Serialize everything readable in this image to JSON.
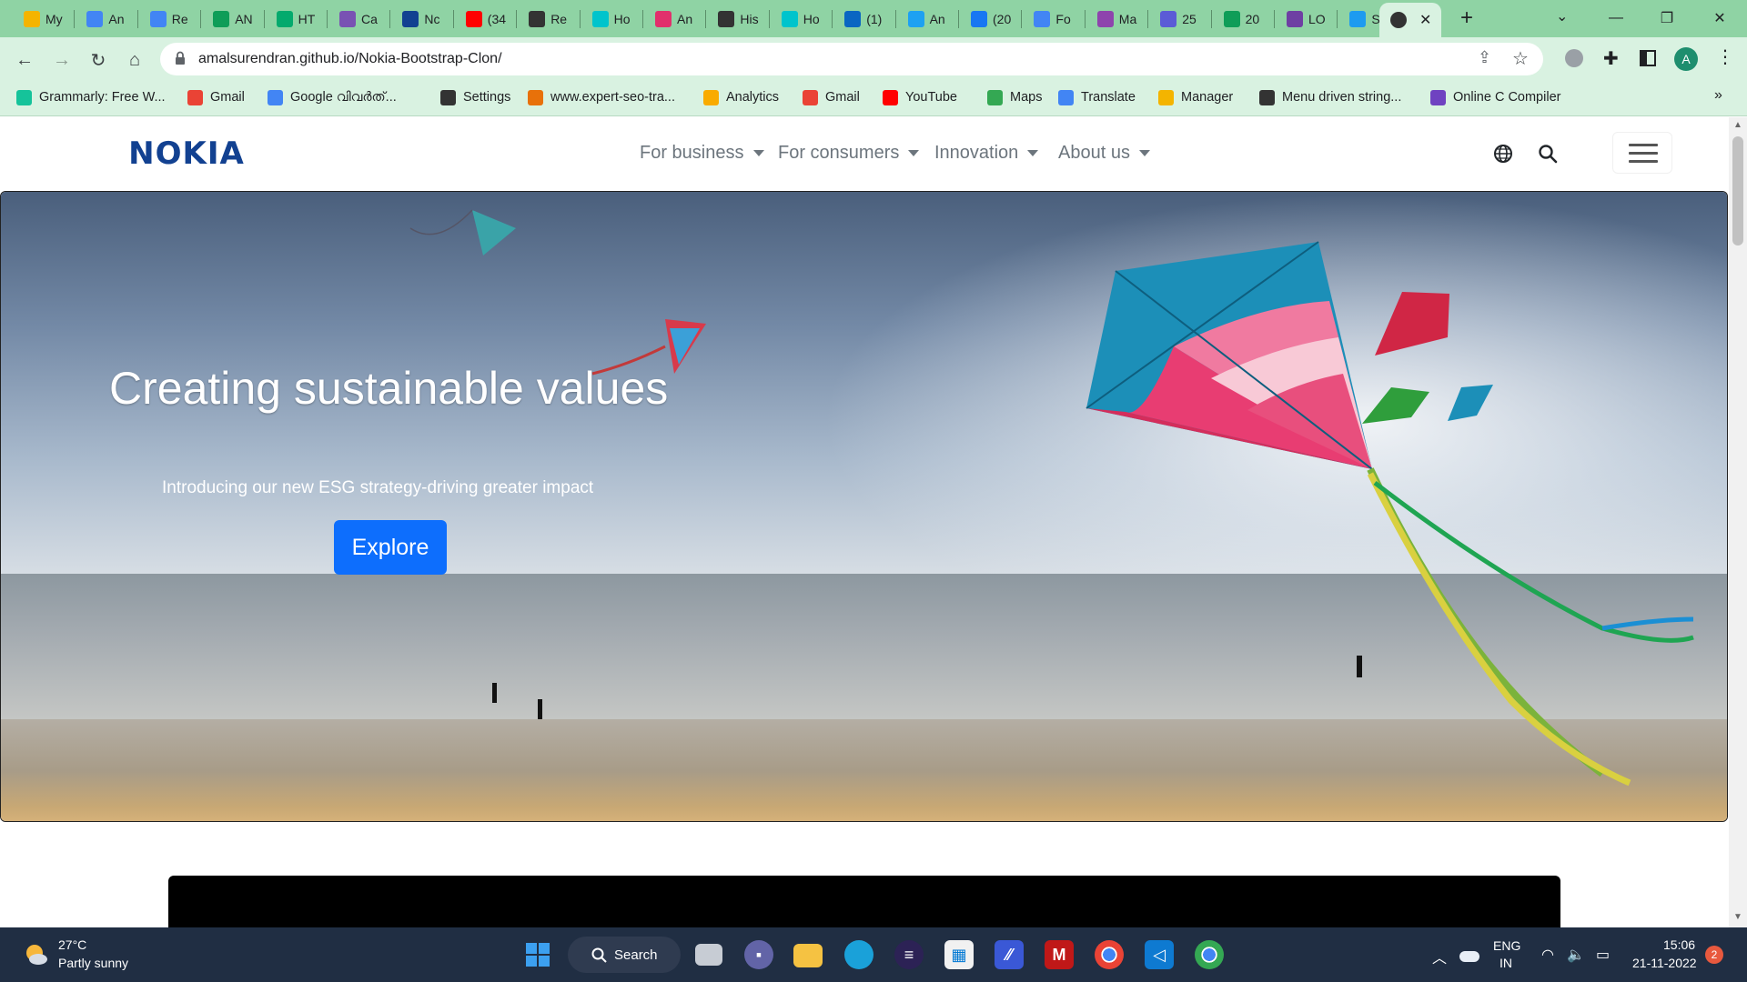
{
  "browser": {
    "tabs": [
      {
        "label": "My",
        "icon": "google-drive-icon",
        "color": "#f4b400"
      },
      {
        "label": "An",
        "icon": "google-docs-icon",
        "color": "#4285f4"
      },
      {
        "label": "Re",
        "icon": "google-docs-icon",
        "color": "#4285f4"
      },
      {
        "label": "AN",
        "icon": "google-sheets-icon",
        "color": "#0f9d58"
      },
      {
        "label": "HT",
        "icon": "w3schools-icon",
        "color": "#04aa6d"
      },
      {
        "label": "Ca",
        "icon": "bootstrap-icon",
        "color": "#7952b3"
      },
      {
        "label": "Nc",
        "icon": "notion-icon",
        "color": "#124191"
      },
      {
        "label": "(34",
        "icon": "youtube-icon",
        "color": "#ff0000"
      },
      {
        "label": "Re",
        "icon": "globe-icon",
        "color": "#333333"
      },
      {
        "label": "Ho",
        "icon": "canva-icon",
        "color": "#00c4cc"
      },
      {
        "label": "An",
        "icon": "instagram-icon",
        "color": "#e1306c"
      },
      {
        "label": "His",
        "icon": "history-icon",
        "color": "#333333"
      },
      {
        "label": "Ho",
        "icon": "canva-icon",
        "color": "#00c4cc"
      },
      {
        "label": "(1)",
        "icon": "linkedin-icon",
        "color": "#0a66c2"
      },
      {
        "label": "An",
        "icon": "twitter-icon",
        "color": "#1da1f2"
      },
      {
        "label": "(20",
        "icon": "facebook-icon",
        "color": "#1877f2"
      },
      {
        "label": "Fo",
        "icon": "feedback-icon",
        "color": "#4285f4"
      },
      {
        "label": "Ma",
        "icon": "messenger-icon",
        "color": "#8e44ad"
      },
      {
        "label": "25",
        "icon": "app-icon",
        "color": "#5b5bd6"
      },
      {
        "label": "20",
        "icon": "forms-icon",
        "color": "#0f9d58"
      },
      {
        "label": "LO",
        "icon": "github-icon",
        "color": "#6e3fa3"
      },
      {
        "label": "Sk",
        "icon": "bird-icon",
        "color": "#1d9bf0"
      }
    ],
    "url": "amalsurendran.github.io/Nokia-Bootstrap-Clon/",
    "profile_initial": "A",
    "bookmarks": [
      {
        "label": "Grammarly: Free W...",
        "icon": "grammarly-icon",
        "color": "#15c39a"
      },
      {
        "label": "Gmail",
        "icon": "gmail-icon",
        "color": "#ea4335"
      },
      {
        "label": "Google വിവർത്...",
        "icon": "translate-icon",
        "color": "#4285f4"
      },
      {
        "label": "Settings",
        "icon": "gear-icon",
        "color": "#333333"
      },
      {
        "label": "www.expert-seo-tra...",
        "icon": "seo-icon",
        "color": "#e8710a"
      },
      {
        "label": "Analytics",
        "icon": "analytics-icon",
        "color": "#f9ab00"
      },
      {
        "label": "Gmail",
        "icon": "gmail-icon",
        "color": "#ea4335"
      },
      {
        "label": "YouTube",
        "icon": "youtube-icon",
        "color": "#ff0000"
      },
      {
        "label": "Maps",
        "icon": "maps-icon",
        "color": "#34a853"
      },
      {
        "label": "Translate",
        "icon": "translate-icon",
        "color": "#4285f4"
      },
      {
        "label": "Manager",
        "icon": "manager-icon",
        "color": "#f4b400"
      },
      {
        "label": "Menu driven string...",
        "icon": "globe-icon",
        "color": "#333333"
      },
      {
        "label": "Online C Compiler",
        "icon": "compiler-icon",
        "color": "#6f42c1"
      }
    ]
  },
  "site": {
    "logo": "NOKIA",
    "nav": [
      "For business",
      "For consumers",
      "Innovation",
      "About us"
    ],
    "hero": {
      "title": "Creating sustainable values",
      "subtitle": "Introducing our new ESG strategy-driving greater impact",
      "button": "Explore"
    }
  },
  "taskbar": {
    "weather_temp": "27°C",
    "weather_desc": "Partly sunny",
    "search_label": "Search",
    "lang": "ENG",
    "region": "IN",
    "time": "15:06",
    "date": "21-11-2022",
    "notifications": "2"
  },
  "colors": {
    "brand": "#124191",
    "button": "#0d6efd",
    "tabstrip": "#8fd3a4",
    "toolbar": "#d9f2e1",
    "taskbar": "#202e43"
  }
}
